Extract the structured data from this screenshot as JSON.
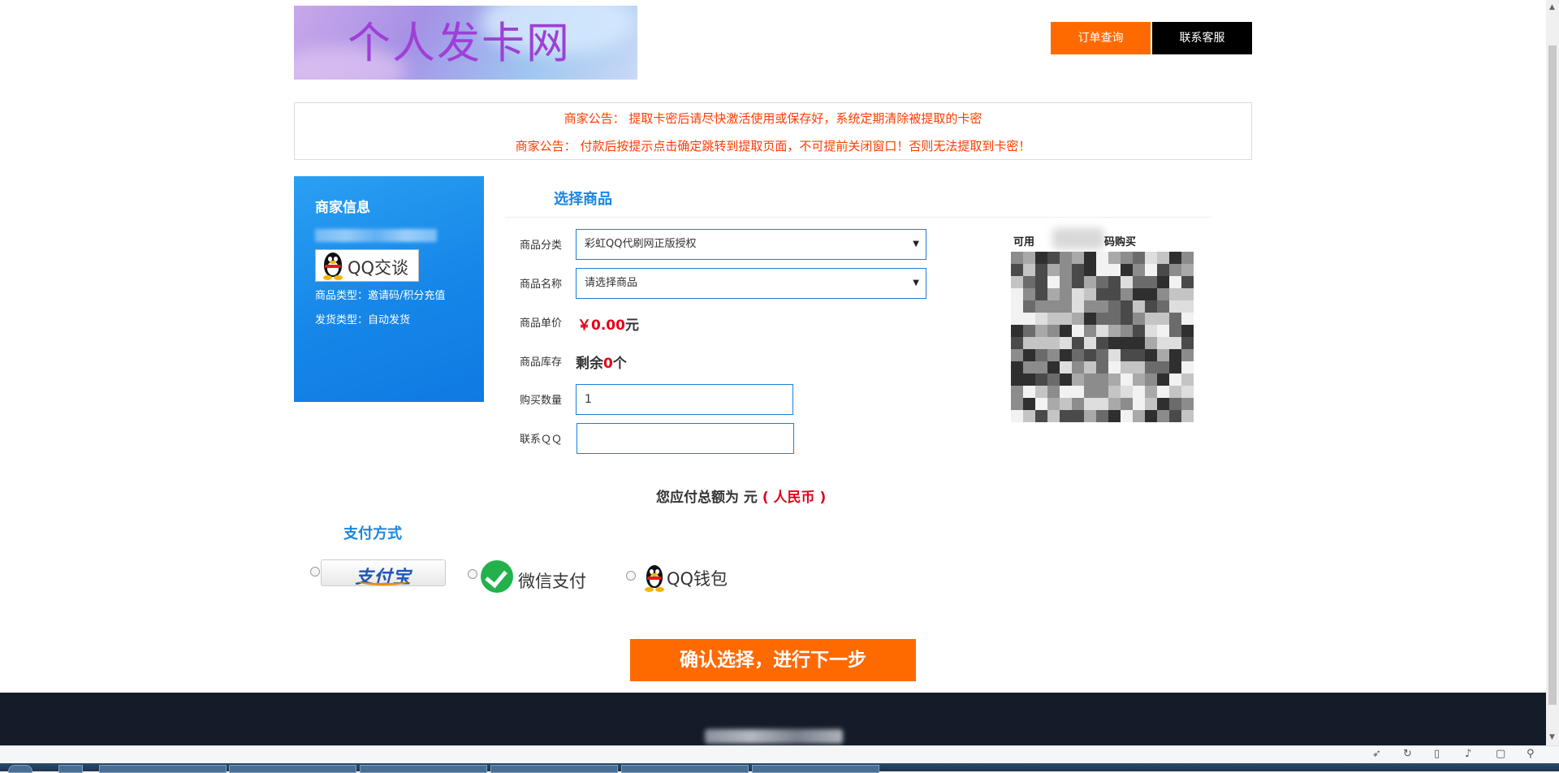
{
  "header": {
    "logo_text": "个人发卡网",
    "order_query_label": "订单查询",
    "contact_label": "联系客服"
  },
  "notice": {
    "line1": "商家公告： 提取卡密后请尽快激活使用或保存好，系统定期清除被提取的卡密",
    "line2": "商家公告： 付款后按提示点击确定跳转到提取页面，不可提前关闭窗口！否则无法提取到卡密！"
  },
  "merchant": {
    "title": "商家信息",
    "qq_chat_label": "QQ交谈",
    "goods_type": "商品类型：邀请码/积分充值",
    "delivery_type": "发货类型：自动发货"
  },
  "product": {
    "section_title": "选择商品",
    "category_label": "商品分类",
    "category_value": "彩虹QQ代刷网正版授权",
    "name_label": "商品名称",
    "name_value": "请选择商品",
    "price_label": "商品单价",
    "price_value": "￥0.00",
    "price_unit": "元",
    "stock_label": "商品库存",
    "stock_prefix": "剩余",
    "stock_count": "0",
    "stock_unit": "个",
    "quantity_label": "购买数量",
    "quantity_value": "1",
    "contact_qq_label": "联系ＱＱ",
    "contact_qq_value": ""
  },
  "qr": {
    "caption_left": "可用",
    "caption_right": "码购买"
  },
  "total": {
    "prefix": "您应付总额为 元",
    "currency": "( 人民币 )"
  },
  "payment": {
    "section_title": "支付方式",
    "alipay_label": "支付宝",
    "wechat_label": "微信支付",
    "qq_wallet_label": "QQ钱包"
  },
  "confirm_label": "确认选择，进行下一步",
  "colors": {
    "accent_orange": "#ff6a00",
    "accent_blue": "#1a86e0",
    "notice_red": "#ff3c00",
    "price_red": "#e4001b",
    "footer_bg": "#141c2a"
  }
}
